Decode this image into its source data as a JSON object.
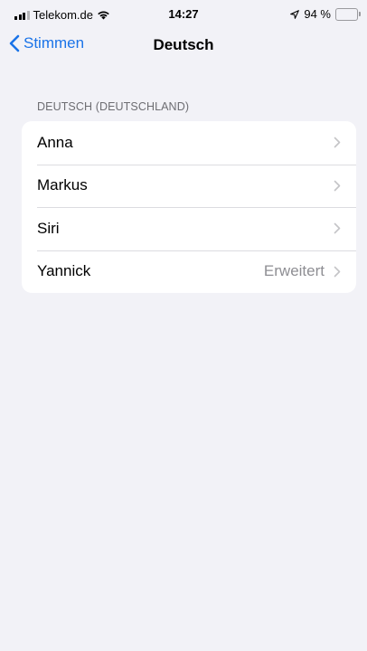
{
  "status_bar": {
    "carrier": "Telekom.de",
    "time": "14:27",
    "battery_percent": "94 %",
    "battery_level": 0.94
  },
  "nav": {
    "back_label": "Stimmen",
    "title": "Deutsch"
  },
  "section": {
    "header": "DEUTSCH (DEUTSCHLAND)"
  },
  "voices": [
    {
      "label": "Anna",
      "detail": ""
    },
    {
      "label": "Markus",
      "detail": ""
    },
    {
      "label": "Siri",
      "detail": ""
    },
    {
      "label": "Yannick",
      "detail": "Erweitert"
    }
  ],
  "colors": {
    "accent": "#1a73e8",
    "background": "#f2f2f7",
    "secondary_text": "#8e8e93"
  }
}
